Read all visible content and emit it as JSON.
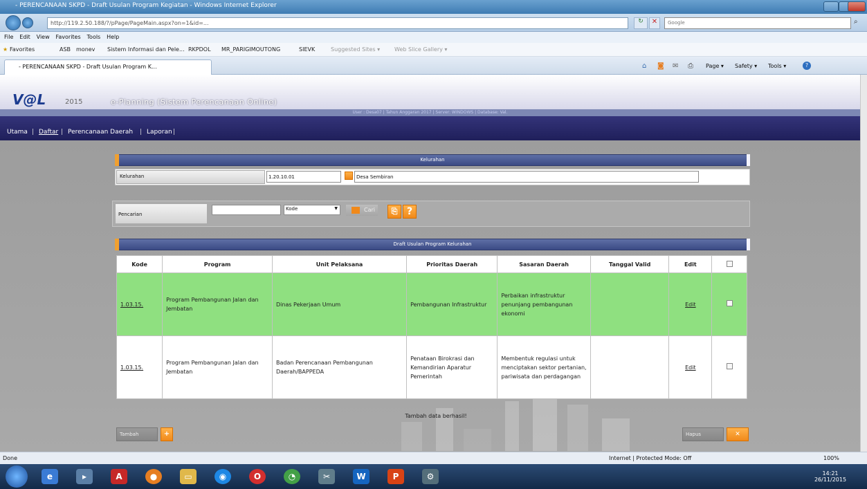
{
  "browser": {
    "title": "- PERENCANAAN SKPD - Draft Usulan Program Kegiatan - Windows Internet Explorer",
    "address": "http://119.2.50.188/?/pPage/PageMain.aspx?on=1&id=...",
    "search_placeholder": "Google",
    "menu": [
      "File",
      "Edit",
      "View",
      "Favorites",
      "Tools",
      "Help"
    ],
    "favorites_label": "Favorites",
    "favorites": [
      "ASB",
      "monev",
      "Sistem Informasi dan Pele...",
      "RKPDOL",
      "MR_PARIGIMOUTONG",
      "SIEVK",
      "Suggested Sites ▾",
      "Web Slice Gallery ▾"
    ],
    "tab_title": "- PERENCANAAN SKPD - Draft Usulan Program K...",
    "command_items": [
      "Page ▾",
      "Safety ▾",
      "Tools ▾"
    ]
  },
  "app": {
    "logo": "V@L",
    "logo_year": "2015",
    "title": "e-Planning (Sistem Perencanaan Online)",
    "info": "User : Desa07 | Tahun Anggaran 2017 | Server: WINDOWS | Database: Val.",
    "menu": [
      "Utama",
      "Daftar",
      "Perencanaan Daerah",
      "Laporan"
    ]
  },
  "kelurahan": {
    "header": "Kelurahan",
    "label": "Kelurahan",
    "code": "1.20.10.01",
    "name": "Desa Sembiran"
  },
  "search": {
    "label": "Pencarian",
    "value": "",
    "select": "Kode",
    "cari": "Cari",
    "help": "?"
  },
  "grid": {
    "header": "Draft Usulan Program Kelurahan",
    "columns": [
      "Kode",
      "Program",
      "Unit Pelaksana",
      "Prioritas Daerah",
      "Sasaran Daerah",
      "Tanggal Valid",
      "Edit"
    ],
    "rows": [
      {
        "kode": "1.03.15.",
        "program": "Program Pembangunan Jalan dan Jembatan",
        "unit": "Dinas Pekerjaan Umum",
        "prioritas": "Pembangunan Infrastruktur",
        "sasaran": "Perbaikan infrastruktur penunjang pembangunan ekonomi",
        "tanggal": "",
        "edit": "Edit"
      },
      {
        "kode": "1.03.15.",
        "program": "Program Pembangunan Jalan dan Jembatan",
        "unit": "Badan Perencanaan Pembangunan Daerah/BAPPEDA",
        "prioritas": "Penataan Birokrasi dan Kemandirian Aparatur Pemerintah",
        "sasaran": "Membentuk regulasi untuk menciptakan sektor pertanian, pariwisata dan perdagangan",
        "tanggal": "",
        "edit": "Edit"
      }
    ],
    "message": "Tambah data berhasil!",
    "tambah": "Tambah",
    "hapus": "Hapus"
  },
  "status": {
    "left": "Done",
    "zone": "Internet | Protected Mode: Off",
    "zoom": "100%",
    "time": "14:21",
    "date": "26/11/2015"
  }
}
